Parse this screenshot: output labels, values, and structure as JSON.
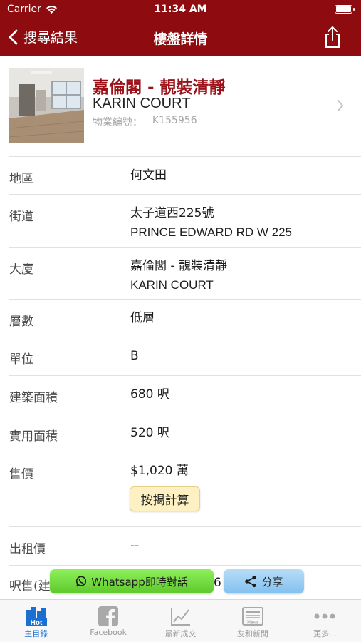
{
  "status": {
    "carrier": "Carrier",
    "time": "11:34 AM"
  },
  "nav": {
    "back_label": "搜尋結果",
    "title": "樓盤詳情"
  },
  "property": {
    "name_zh": "嘉倫閣 - 靚裝清靜",
    "name_en": "KARIN COURT",
    "ref_label": "物業編號：",
    "ref_value": "K155956"
  },
  "details": [
    {
      "label": "地區",
      "value": "何文田"
    },
    {
      "label": "街道",
      "value": "太子道西225號",
      "value2": "PRINCE EDWARD RD W 225"
    },
    {
      "label": "大廈",
      "value": "嘉倫閣 - 靚裝清靜",
      "value2": "KARIN COURT"
    },
    {
      "label": "層數",
      "value": "低層"
    },
    {
      "label": "單位",
      "value": "B"
    },
    {
      "label": "建築面積",
      "value": "680 呎"
    },
    {
      "label": "實用面積",
      "value": "520 呎"
    },
    {
      "label": "售價",
      "value": "$1,020 萬"
    },
    {
      "label": "出租價",
      "value": "--"
    },
    {
      "label": "呎售(建",
      "value": "6"
    }
  ],
  "mortgage_button": "按揭計算",
  "actions": {
    "whatsapp": "Whatsapp即時對話",
    "share": "分享"
  },
  "tabs": [
    {
      "label": "主目錄",
      "icon": "hot-city-icon"
    },
    {
      "label": "Facebook",
      "icon": "facebook-icon"
    },
    {
      "label": "最新成交",
      "icon": "line-chart-icon"
    },
    {
      "label": "友和新聞",
      "icon": "newspaper-icon"
    },
    {
      "label": "更多...",
      "icon": "more-dots-icon"
    }
  ],
  "colors": {
    "brand": "#8e0c0f",
    "title_red": "#9b1117",
    "active_tab": "#1a6fd1"
  }
}
